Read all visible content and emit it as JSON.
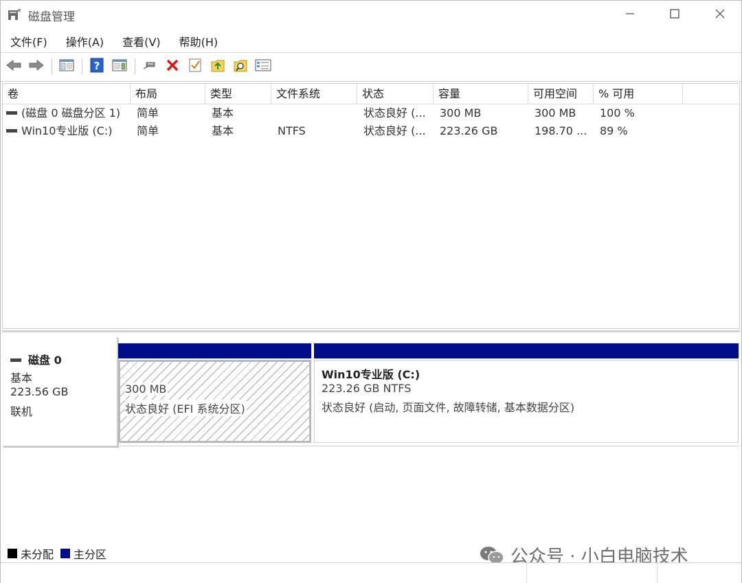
{
  "window": {
    "title": "磁盘管理",
    "icon": "disk-management-icon",
    "controls": [
      "minimize-icon",
      "maximize-icon",
      "close-icon"
    ]
  },
  "menu": [
    "文件(F)",
    "操作(A)",
    "查看(V)",
    "帮助(H)"
  ],
  "toolbar": {
    "buttons": [
      "back-icon",
      "forward-icon",
      "console-tree-icon",
      "help-icon",
      "properties-icon",
      "connect-icon",
      "delete-icon",
      "checklist-icon",
      "export-icon",
      "search-icon",
      "view-icon"
    ]
  },
  "volume_list": {
    "columns": [
      "卷",
      "布局",
      "类型",
      "文件系统",
      "状态",
      "容量",
      "可用空间",
      "% 可用"
    ],
    "rows": [
      {
        "volume": "(磁盘 0 磁盘分区 1)",
        "layout": "简单",
        "type": "基本",
        "fs": "",
        "status": "状态良好 (...",
        "capacity": "300 MB",
        "free": "300 MB",
        "pct": "100 %"
      },
      {
        "volume": "Win10专业版 (C:)",
        "layout": "简单",
        "type": "基本",
        "fs": "NTFS",
        "status": "状态良好 (...",
        "capacity": "223.26 GB",
        "free": "198.70 ...",
        "pct": "89 %"
      }
    ]
  },
  "disk0": {
    "name": "磁盘 0",
    "type": "基本",
    "size": "223.56 GB",
    "status": "联机",
    "partitions": [
      {
        "title": "",
        "size": "300 MB",
        "status": "状态良好 (EFI 系统分区)"
      },
      {
        "title": "Win10专业版  (C:)",
        "size": "223.26 GB NTFS",
        "status": "状态良好 (启动, 页面文件, 故障转储, 基本数据分区)"
      }
    ]
  },
  "legend": [
    {
      "label": "未分配",
      "color": "#000000"
    },
    {
      "label": "主分区",
      "color": "#000d8a"
    }
  ],
  "colors": {
    "primary_partition": "#000d8a",
    "unallocated": "#000000"
  },
  "watermark": {
    "text": "公众号 · 小白电脑技术",
    "icon": "wechat-icon"
  }
}
